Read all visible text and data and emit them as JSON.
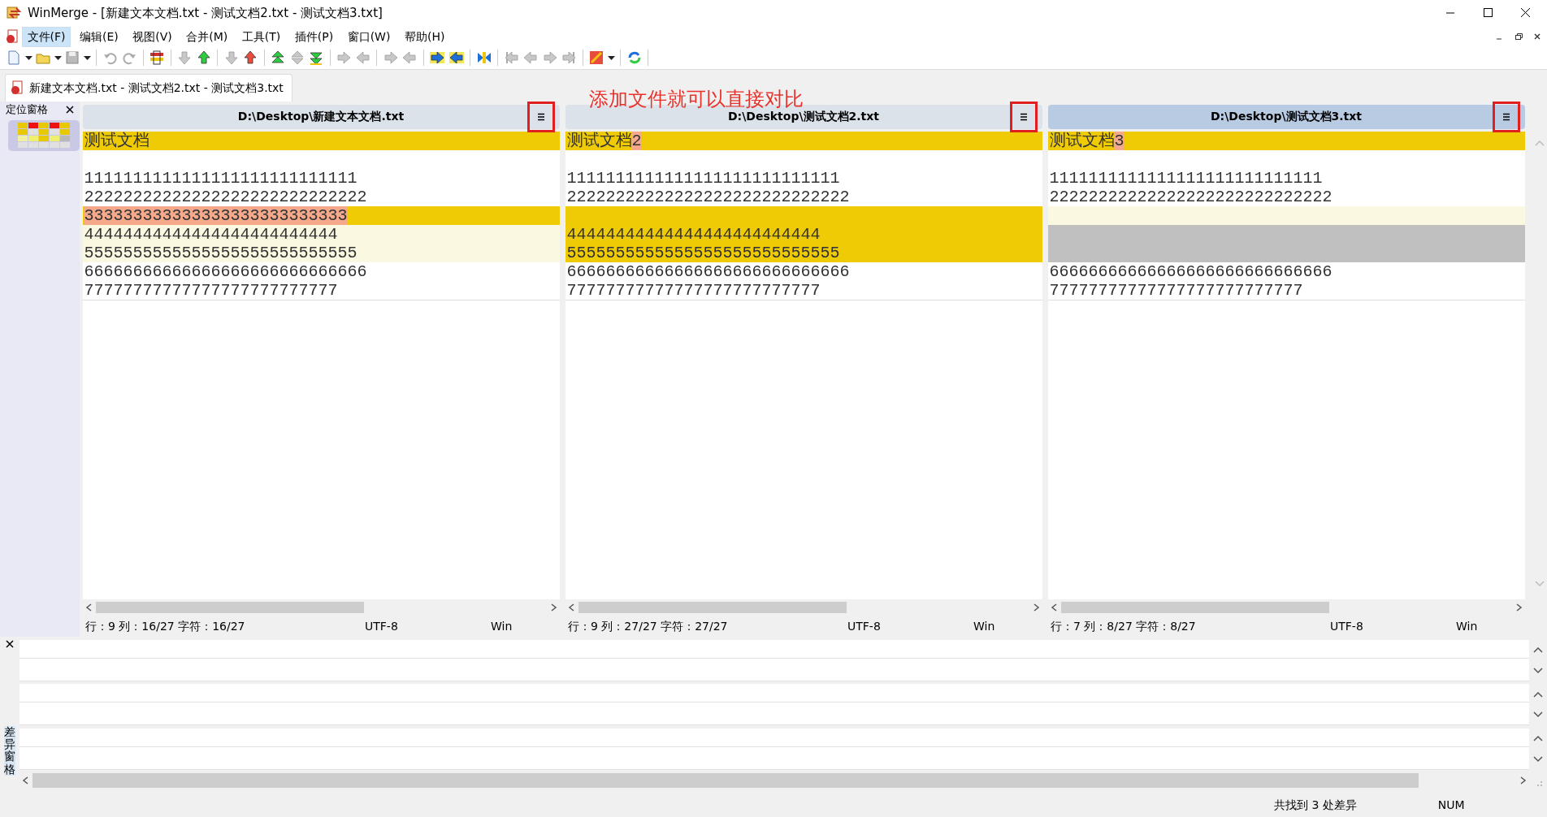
{
  "window": {
    "title": "WinMerge - [新建文本文档.txt - 测试文档2.txt - 测试文档3.txt]"
  },
  "menu": [
    {
      "label": "文件(F)",
      "selected": true
    },
    {
      "label": "编辑(E)",
      "selected": false
    },
    {
      "label": "视图(V)",
      "selected": false
    },
    {
      "label": "合并(M)",
      "selected": false
    },
    {
      "label": "工具(T)",
      "selected": false
    },
    {
      "label": "插件(P)",
      "selected": false
    },
    {
      "label": "窗口(W)",
      "selected": false
    },
    {
      "label": "帮助(H)",
      "selected": false
    }
  ],
  "tabs": [
    {
      "label": "新建文本文档.txt - 测试文档2.txt - 测试文档3.txt",
      "selected": true
    }
  ],
  "location_pane": {
    "title": "定位窗格"
  },
  "annotation": {
    "text": "添加文件就可以直接对比"
  },
  "panes": [
    {
      "path": "D:\\Desktop\\新建文本文档.txt",
      "active": false,
      "menu_highlighted": true,
      "lines": [
        {
          "kind": "selected",
          "segments": [
            {
              "text": "测试文档",
              "changed": false
            }
          ]
        },
        {
          "kind": "equal"
        },
        {
          "kind": "equal",
          "segments": [
            {
              "text": "1111111111111111111111111111",
              "changed": false
            }
          ]
        },
        {
          "kind": "equal",
          "segments": [
            {
              "text": "22222222222222222222222222222",
              "changed": false
            }
          ]
        },
        {
          "kind": "selected",
          "segments": [
            {
              "text": "333333333333333333333333333",
              "changed": true
            }
          ]
        },
        {
          "kind": "diff",
          "segments": [
            {
              "text": "44444444444444444444444444",
              "changed": false
            }
          ]
        },
        {
          "kind": "diff",
          "segments": [
            {
              "text": "5555555555555555555555555555",
              "changed": false
            }
          ]
        },
        {
          "kind": "equal",
          "segments": [
            {
              "text": "66666666666666666666666666666",
              "changed": false
            }
          ]
        },
        {
          "kind": "equal",
          "segments": [
            {
              "text": "77777777777777777777777777",
              "changed": false
            }
          ]
        }
      ],
      "status": {
        "position": "行：9  列：16/27  字符：16/27",
        "encoding": "UTF-8",
        "eol": "Win"
      }
    },
    {
      "path": "D:\\Desktop\\测试文档2.txt",
      "active": false,
      "menu_highlighted": true,
      "lines": [
        {
          "kind": "selected",
          "segments": [
            {
              "text": "测试文档",
              "changed": false
            },
            {
              "text": "2",
              "changed": true
            }
          ]
        },
        {
          "kind": "equal"
        },
        {
          "kind": "equal",
          "segments": [
            {
              "text": "1111111111111111111111111111",
              "changed": false
            }
          ]
        },
        {
          "kind": "equal",
          "segments": [
            {
              "text": "22222222222222222222222222222",
              "changed": false
            }
          ]
        },
        {
          "kind": "selected"
        },
        {
          "kind": "selected",
          "segments": [
            {
              "text": "44444444444444444444444444",
              "changed": false
            }
          ]
        },
        {
          "kind": "selected",
          "segments": [
            {
              "text": "5555555555555555555555555555",
              "changed": false
            }
          ]
        },
        {
          "kind": "equal",
          "segments": [
            {
              "text": "66666666666666666666666666666",
              "changed": false
            }
          ]
        },
        {
          "kind": "equal",
          "segments": [
            {
              "text": "77777777777777777777777777",
              "changed": false
            }
          ]
        }
      ],
      "status": {
        "position": "行：9  列：27/27  字符：27/27",
        "encoding": "UTF-8",
        "eol": "Win"
      }
    },
    {
      "path": "D:\\Desktop\\测试文档3.txt",
      "active": true,
      "menu_highlighted": true,
      "lines": [
        {
          "kind": "selected",
          "segments": [
            {
              "text": "测试文档",
              "changed": false
            },
            {
              "text": "3",
              "changed": true
            }
          ]
        },
        {
          "kind": "equal"
        },
        {
          "kind": "equal",
          "segments": [
            {
              "text": "1111111111111111111111111111",
              "changed": false
            }
          ]
        },
        {
          "kind": "equal",
          "segments": [
            {
              "text": "22222222222222222222222222222",
              "changed": false
            }
          ]
        },
        {
          "kind": "diff"
        },
        {
          "kind": "missing"
        },
        {
          "kind": "missing"
        },
        {
          "kind": "equal",
          "segments": [
            {
              "text": "66666666666666666666666666666",
              "changed": false
            }
          ]
        },
        {
          "kind": "equal",
          "segments": [
            {
              "text": "77777777777777777777777777",
              "changed": false
            }
          ]
        }
      ],
      "status": {
        "position": "行：7  列：8/27  字符：8/27",
        "encoding": "UTF-8",
        "eol": "Win"
      }
    }
  ],
  "diff_pane": {
    "title": "差异窗格"
  },
  "status_bar": {
    "message": "共找到 3 处差异",
    "indicator": "NUM"
  }
}
